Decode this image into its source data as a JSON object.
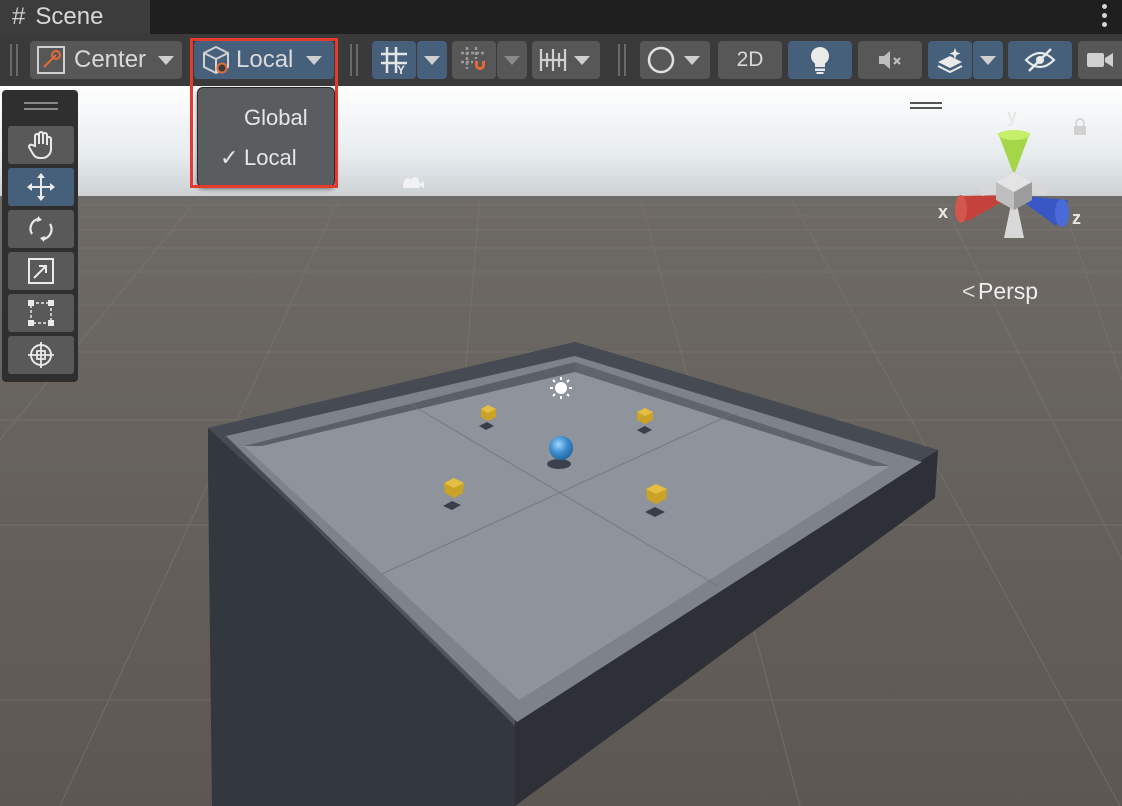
{
  "tab": {
    "title": "Scene"
  },
  "toolbar": {
    "pivot_label": "Center",
    "space_label": "Local",
    "mode_2d_label": "2D"
  },
  "space_menu": {
    "items": [
      {
        "label": "Global",
        "checked": false
      },
      {
        "label": "Local",
        "checked": true
      }
    ],
    "check_glyph": "✓"
  },
  "gizmo": {
    "x_label": "x",
    "y_label": "y",
    "z_label": "z",
    "view_label": "Persp"
  },
  "colors": {
    "highlight": "#e53a2d",
    "active_button": "#46607c",
    "pickup": "#c9a227",
    "player": "#3f8fd0"
  }
}
